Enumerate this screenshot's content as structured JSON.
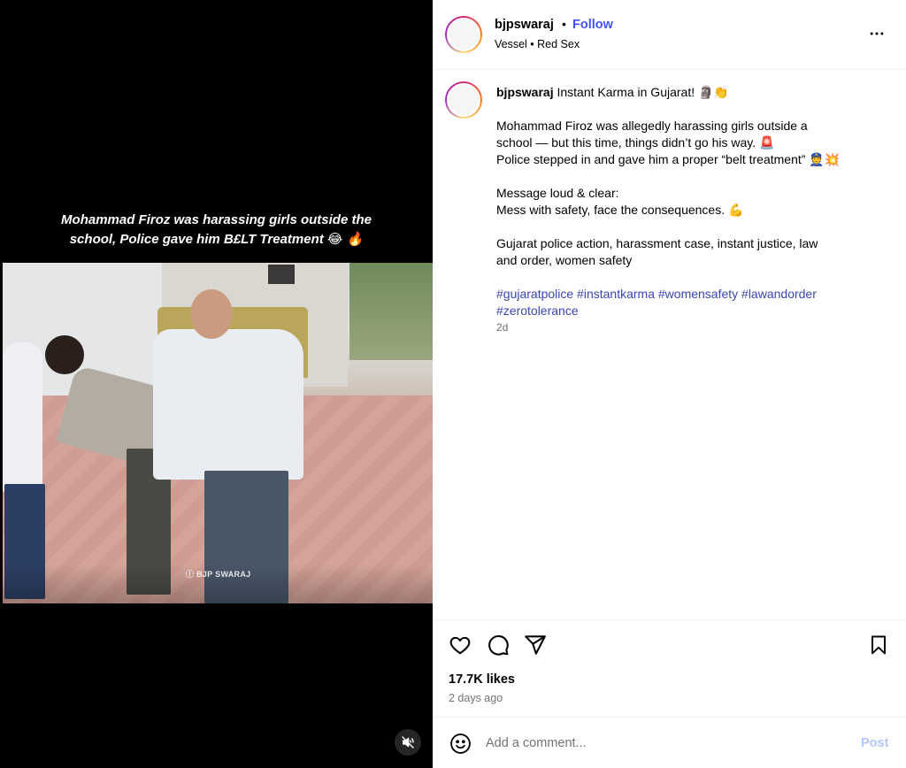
{
  "media": {
    "caption_line1": "Mohammad Firoz was harassing girls outside the",
    "caption_line2": "school, Police gave him B£LT Treatment 😂 🔥",
    "watermark": "ⓘ BJP SWARAJ",
    "mute_icon": "muted-speaker-icon"
  },
  "header": {
    "username": "bjpswaraj",
    "separator": "•",
    "follow_label": "Follow",
    "subline": "Vessel • Red Sex"
  },
  "caption": {
    "username": "bjpswaraj",
    "title": " Instant Karma in Gujarat! 🗿👏",
    "para1_line1": "Mohammad Firoz was allegedly harassing girls outside a",
    "para1_line2": "school — but this time, things didn’t go his way. 🚨",
    "para1_line3": "Police stepped in and gave him a proper “belt treatment” 👮💥",
    "para2_line1": "Message loud & clear:",
    "para2_line2": "Mess with safety, face the consequences. 💪",
    "para3_line1": "Gujarat police action, harassment case, instant justice, law",
    "para3_line2": "and order, women safety",
    "hashtags_line1": "#gujaratpolice #instantkarma #womensafety #lawandorder",
    "hashtags_line2": "#zerotolerance",
    "age": "2d"
  },
  "actions": {
    "likes": "17.7K likes",
    "date": "2 days ago"
  },
  "comment": {
    "placeholder": "Add a comment...",
    "post_label": "Post"
  },
  "colors": {
    "follow": "#4150f7",
    "hashtag": "#3847b0",
    "post_disabled": "#b3c7fb",
    "secondary_text": "#737373"
  }
}
